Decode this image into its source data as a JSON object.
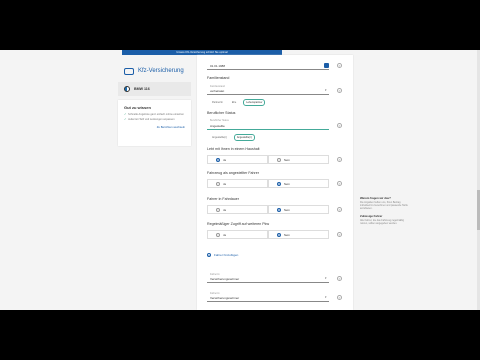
{
  "topbar": {
    "text": "Unsere Kfz-Versicherung schützt Sie optimal"
  },
  "brand": {
    "name": "Kfz-Versicherung"
  },
  "car": {
    "model": "BMW 116"
  },
  "help_card": {
    "title": "Gut zu wissen",
    "items": [
      "Schnelle Angebote ganz einfach online einsehen",
      "Jederzeit Tarif und Leistungen anpassen"
    ],
    "link": "Zu Berichten wechseln"
  },
  "form": {
    "date_value": "01.01.1988",
    "familienstand_label": "Familienstand",
    "familienstand_sublabel": "Familienstand",
    "familienstand_value": "verheiratet",
    "partner_label": "Partner/in",
    "chips": [
      "Ehe",
      "Lebenspartner"
    ],
    "beruf_label": "Beruflicher Status",
    "beruf_sublabel": "Beruflicher Status",
    "beruf_value": "Angestellte",
    "beruf_chip_label": "Angestellte(r)",
    "beruf_chip_active": "Angestellte(r)",
    "q1": "Lebt mit Ihnen in einem Haushalt",
    "q1_opts": [
      "Ja",
      "Nein"
    ],
    "q2": "Fahrzeug als angestellter Fahrer",
    "q2_opts": [
      "Ja",
      "Nein"
    ],
    "q3": "Fahrer in Fahrdauer",
    "q3_opts": [
      "Ja",
      "Nein"
    ],
    "q4": "Regelmäßiger Zugriff auf weiteren Pkw",
    "q4_opts": [
      "Ja",
      "Nein"
    ],
    "add_driver": "Fahrer hinzufügen",
    "select1_sublabel": "Fahrer/in",
    "select1_value": "Versicherungsnehmer",
    "select2_sublabel": "Fahrer/in",
    "select2_value": "Versicherungsnehmer"
  },
  "right_panel": {
    "h1": "Warum fragen wir das?",
    "p1": "Die Angaben helfen uns, Ihren Beitrag individuell zu berechnen und passende Tarife anzubieten.",
    "h2": "Zulässige Fahrer",
    "p2": "Alle Fahrer, die das Fahrzeug regelmäßig nutzen, sollten angegeben werden."
  }
}
